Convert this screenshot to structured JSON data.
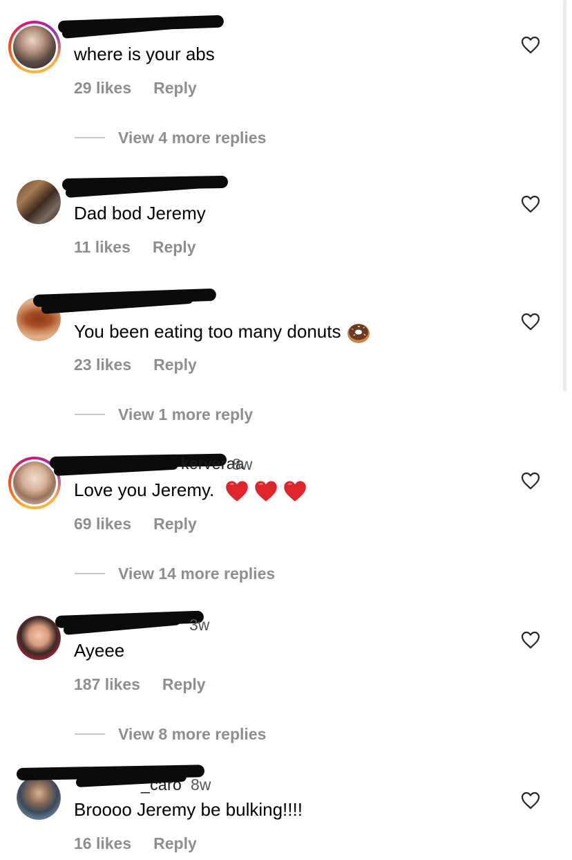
{
  "comments": [
    {
      "username_visible": "",
      "time": "",
      "text": "where is your abs",
      "likes": "29 likes",
      "reply": "Reply",
      "view_more": "View 4 more replies"
    },
    {
      "username_visible": "_",
      "time": "",
      "text": "Dad bod Jeremy",
      "likes": "11 likes",
      "reply": "Reply",
      "view_more": ""
    },
    {
      "username_visible": "",
      "time": "",
      "text": "You been eating too many donuts",
      "emoji": "donut",
      "likes": "23 likes",
      "reply": "Reply",
      "view_more": "View 1 more reply"
    },
    {
      "username_visible": "kerveraa",
      "time": "8w",
      "text": "Love you Jeremy.",
      "emoji": "red-heart x3",
      "likes": "69 likes",
      "reply": "Reply",
      "view_more": "View 14 more replies"
    },
    {
      "username_visible": "",
      "time": "3w",
      "text": "Ayeee",
      "likes": "187 likes",
      "reply": "Reply",
      "view_more": "View 8 more replies"
    },
    {
      "username_visible": "_caro",
      "time": "8w",
      "text": "Broooo Jeremy be bulking!!!!",
      "likes": "16 likes",
      "reply": "Reply",
      "view_more": ""
    }
  ],
  "colors": {
    "meta_text": "#8e8e8e",
    "divider": "#c8c8c8",
    "heart_stroke": "#262626",
    "story_ring": "#d3137b"
  },
  "icons": {
    "like": "heart-outline-icon"
  }
}
